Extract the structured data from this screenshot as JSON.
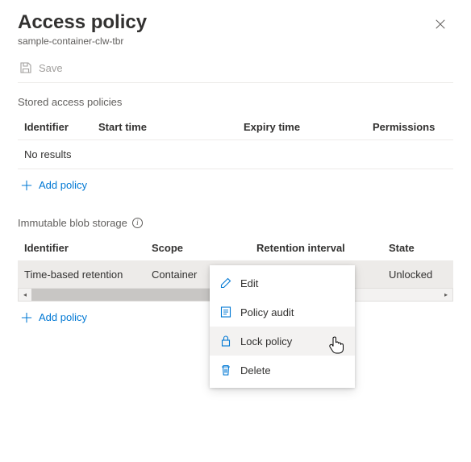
{
  "header": {
    "title": "Access policy",
    "subtitle": "sample-container-clw-tbr"
  },
  "toolbar": {
    "save_label": "Save"
  },
  "stored": {
    "section_label": "Stored access policies",
    "columns": {
      "identifier": "Identifier",
      "start": "Start time",
      "expiry": "Expiry time",
      "perm": "Permissions"
    },
    "empty_text": "No results",
    "add_label": "Add policy"
  },
  "immutable": {
    "section_label": "Immutable blob storage",
    "columns": {
      "identifier": "Identifier",
      "scope": "Scope",
      "retention": "Retention interval",
      "state": "State"
    },
    "rows": [
      {
        "identifier": "Time-based retention",
        "scope": "Container",
        "retention": "",
        "state": "Unlocked"
      }
    ],
    "add_label": "Add policy"
  },
  "context_menu": {
    "edit": "Edit",
    "audit": "Policy audit",
    "lock": "Lock policy",
    "delete": "Delete"
  }
}
